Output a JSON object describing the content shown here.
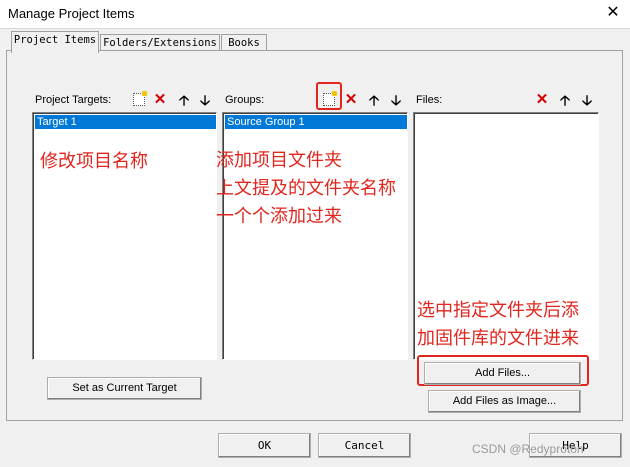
{
  "window": {
    "title": "Manage Project Items",
    "close_glyph": "✕"
  },
  "tabs": [
    {
      "label": "Project Items",
      "active": true
    },
    {
      "label": "Folders/Extensions",
      "active": false
    },
    {
      "label": "Books",
      "active": false
    }
  ],
  "targets_panel": {
    "title": "Project Targets:",
    "items": [
      "Target 1"
    ],
    "selected": "Target 1"
  },
  "groups_panel": {
    "title": "Groups:",
    "items": [
      "Source Group 1"
    ],
    "selected": "Source Group 1"
  },
  "files_panel": {
    "title": "Files:",
    "items": []
  },
  "buttons": {
    "set_current_target": "Set as Current Target",
    "add_files": "Add Files...",
    "add_files_image": "Add Files as Image...",
    "ok": "OK",
    "cancel": "Cancel",
    "help": "Help"
  },
  "icons": {
    "new": "new-item-icon",
    "delete": "delete-icon",
    "up": "move-up-icon",
    "down": "move-down-icon",
    "delete_glyph": "✕",
    "up_glyph": "🡡",
    "down_glyph": "🡣"
  },
  "annotations": {
    "rename_note": "修改项目名称",
    "group_note_line1": "添加项目文件夹",
    "group_note_line2": "上文提及的文件夹名称",
    "group_note_line3": "一个个添加过来",
    "files_note_line1": "选中指定文件夹后添",
    "files_note_line2": "加固件库的文件进来",
    "highlight_color": "#e0261e"
  },
  "watermark": "CSDN @Redyproton"
}
